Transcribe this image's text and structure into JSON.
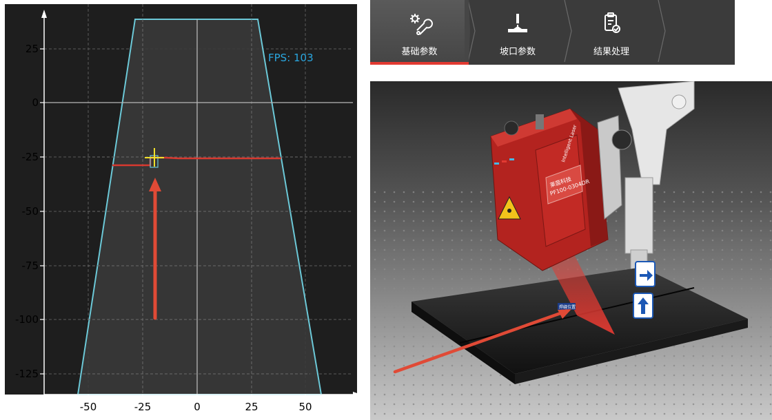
{
  "plot": {
    "fps_text": "FPS: 103",
    "x_ticks": [
      "-50",
      "-25",
      "0",
      "25",
      "50"
    ],
    "y_ticks": [
      "25",
      "0",
      "-25",
      "-50",
      "-75",
      "-100",
      "-125"
    ]
  },
  "tabs": [
    {
      "label": "基础参数",
      "icon": "gear-wrench-icon",
      "active": true
    },
    {
      "label": "坡口参数",
      "icon": "welding-torch-icon",
      "active": false
    },
    {
      "label": "结果处理",
      "icon": "clipboard-check-icon",
      "active": false
    }
  ],
  "sensor": {
    "brand": "Intelligent Laser",
    "model": "PF100-0304DR",
    "label_cn": "莱茵科技",
    "seam_label": "焊缝位置"
  },
  "colors": {
    "accent_red": "#e23a32",
    "fov_outline": "#6cc9d8",
    "fps_text": "#2aa7e0",
    "crosshair": "#f1e12a"
  }
}
